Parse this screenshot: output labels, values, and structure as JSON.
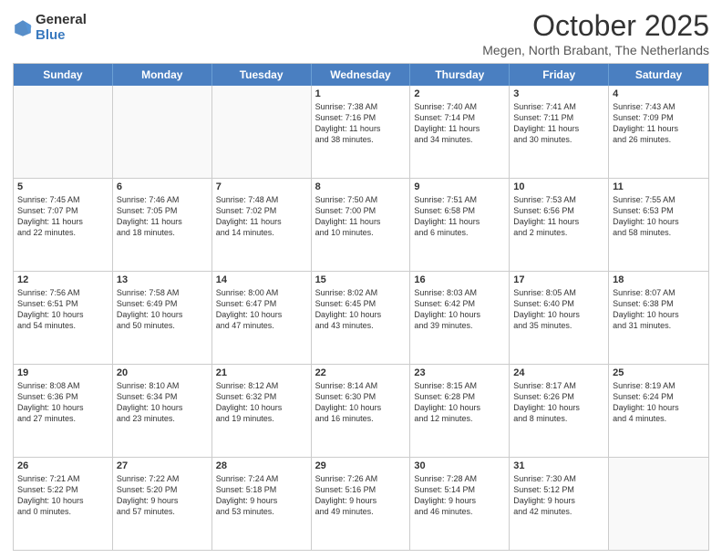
{
  "logo": {
    "general": "General",
    "blue": "Blue"
  },
  "header": {
    "title": "October 2025",
    "subtitle": "Megen, North Brabant, The Netherlands"
  },
  "days": [
    "Sunday",
    "Monday",
    "Tuesday",
    "Wednesday",
    "Thursday",
    "Friday",
    "Saturday"
  ],
  "weeks": [
    [
      {
        "day": "",
        "lines": []
      },
      {
        "day": "",
        "lines": []
      },
      {
        "day": "",
        "lines": []
      },
      {
        "day": "1",
        "lines": [
          "Sunrise: 7:38 AM",
          "Sunset: 7:16 PM",
          "Daylight: 11 hours",
          "and 38 minutes."
        ]
      },
      {
        "day": "2",
        "lines": [
          "Sunrise: 7:40 AM",
          "Sunset: 7:14 PM",
          "Daylight: 11 hours",
          "and 34 minutes."
        ]
      },
      {
        "day": "3",
        "lines": [
          "Sunrise: 7:41 AM",
          "Sunset: 7:11 PM",
          "Daylight: 11 hours",
          "and 30 minutes."
        ]
      },
      {
        "day": "4",
        "lines": [
          "Sunrise: 7:43 AM",
          "Sunset: 7:09 PM",
          "Daylight: 11 hours",
          "and 26 minutes."
        ]
      }
    ],
    [
      {
        "day": "5",
        "lines": [
          "Sunrise: 7:45 AM",
          "Sunset: 7:07 PM",
          "Daylight: 11 hours",
          "and 22 minutes."
        ]
      },
      {
        "day": "6",
        "lines": [
          "Sunrise: 7:46 AM",
          "Sunset: 7:05 PM",
          "Daylight: 11 hours",
          "and 18 minutes."
        ]
      },
      {
        "day": "7",
        "lines": [
          "Sunrise: 7:48 AM",
          "Sunset: 7:02 PM",
          "Daylight: 11 hours",
          "and 14 minutes."
        ]
      },
      {
        "day": "8",
        "lines": [
          "Sunrise: 7:50 AM",
          "Sunset: 7:00 PM",
          "Daylight: 11 hours",
          "and 10 minutes."
        ]
      },
      {
        "day": "9",
        "lines": [
          "Sunrise: 7:51 AM",
          "Sunset: 6:58 PM",
          "Daylight: 11 hours",
          "and 6 minutes."
        ]
      },
      {
        "day": "10",
        "lines": [
          "Sunrise: 7:53 AM",
          "Sunset: 6:56 PM",
          "Daylight: 11 hours",
          "and 2 minutes."
        ]
      },
      {
        "day": "11",
        "lines": [
          "Sunrise: 7:55 AM",
          "Sunset: 6:53 PM",
          "Daylight: 10 hours",
          "and 58 minutes."
        ]
      }
    ],
    [
      {
        "day": "12",
        "lines": [
          "Sunrise: 7:56 AM",
          "Sunset: 6:51 PM",
          "Daylight: 10 hours",
          "and 54 minutes."
        ]
      },
      {
        "day": "13",
        "lines": [
          "Sunrise: 7:58 AM",
          "Sunset: 6:49 PM",
          "Daylight: 10 hours",
          "and 50 minutes."
        ]
      },
      {
        "day": "14",
        "lines": [
          "Sunrise: 8:00 AM",
          "Sunset: 6:47 PM",
          "Daylight: 10 hours",
          "and 47 minutes."
        ]
      },
      {
        "day": "15",
        "lines": [
          "Sunrise: 8:02 AM",
          "Sunset: 6:45 PM",
          "Daylight: 10 hours",
          "and 43 minutes."
        ]
      },
      {
        "day": "16",
        "lines": [
          "Sunrise: 8:03 AM",
          "Sunset: 6:42 PM",
          "Daylight: 10 hours",
          "and 39 minutes."
        ]
      },
      {
        "day": "17",
        "lines": [
          "Sunrise: 8:05 AM",
          "Sunset: 6:40 PM",
          "Daylight: 10 hours",
          "and 35 minutes."
        ]
      },
      {
        "day": "18",
        "lines": [
          "Sunrise: 8:07 AM",
          "Sunset: 6:38 PM",
          "Daylight: 10 hours",
          "and 31 minutes."
        ]
      }
    ],
    [
      {
        "day": "19",
        "lines": [
          "Sunrise: 8:08 AM",
          "Sunset: 6:36 PM",
          "Daylight: 10 hours",
          "and 27 minutes."
        ]
      },
      {
        "day": "20",
        "lines": [
          "Sunrise: 8:10 AM",
          "Sunset: 6:34 PM",
          "Daylight: 10 hours",
          "and 23 minutes."
        ]
      },
      {
        "day": "21",
        "lines": [
          "Sunrise: 8:12 AM",
          "Sunset: 6:32 PM",
          "Daylight: 10 hours",
          "and 19 minutes."
        ]
      },
      {
        "day": "22",
        "lines": [
          "Sunrise: 8:14 AM",
          "Sunset: 6:30 PM",
          "Daylight: 10 hours",
          "and 16 minutes."
        ]
      },
      {
        "day": "23",
        "lines": [
          "Sunrise: 8:15 AM",
          "Sunset: 6:28 PM",
          "Daylight: 10 hours",
          "and 12 minutes."
        ]
      },
      {
        "day": "24",
        "lines": [
          "Sunrise: 8:17 AM",
          "Sunset: 6:26 PM",
          "Daylight: 10 hours",
          "and 8 minutes."
        ]
      },
      {
        "day": "25",
        "lines": [
          "Sunrise: 8:19 AM",
          "Sunset: 6:24 PM",
          "Daylight: 10 hours",
          "and 4 minutes."
        ]
      }
    ],
    [
      {
        "day": "26",
        "lines": [
          "Sunrise: 7:21 AM",
          "Sunset: 5:22 PM",
          "Daylight: 10 hours",
          "and 0 minutes."
        ]
      },
      {
        "day": "27",
        "lines": [
          "Sunrise: 7:22 AM",
          "Sunset: 5:20 PM",
          "Daylight: 9 hours",
          "and 57 minutes."
        ]
      },
      {
        "day": "28",
        "lines": [
          "Sunrise: 7:24 AM",
          "Sunset: 5:18 PM",
          "Daylight: 9 hours",
          "and 53 minutes."
        ]
      },
      {
        "day": "29",
        "lines": [
          "Sunrise: 7:26 AM",
          "Sunset: 5:16 PM",
          "Daylight: 9 hours",
          "and 49 minutes."
        ]
      },
      {
        "day": "30",
        "lines": [
          "Sunrise: 7:28 AM",
          "Sunset: 5:14 PM",
          "Daylight: 9 hours",
          "and 46 minutes."
        ]
      },
      {
        "day": "31",
        "lines": [
          "Sunrise: 7:30 AM",
          "Sunset: 5:12 PM",
          "Daylight: 9 hours",
          "and 42 minutes."
        ]
      },
      {
        "day": "",
        "lines": []
      }
    ]
  ]
}
